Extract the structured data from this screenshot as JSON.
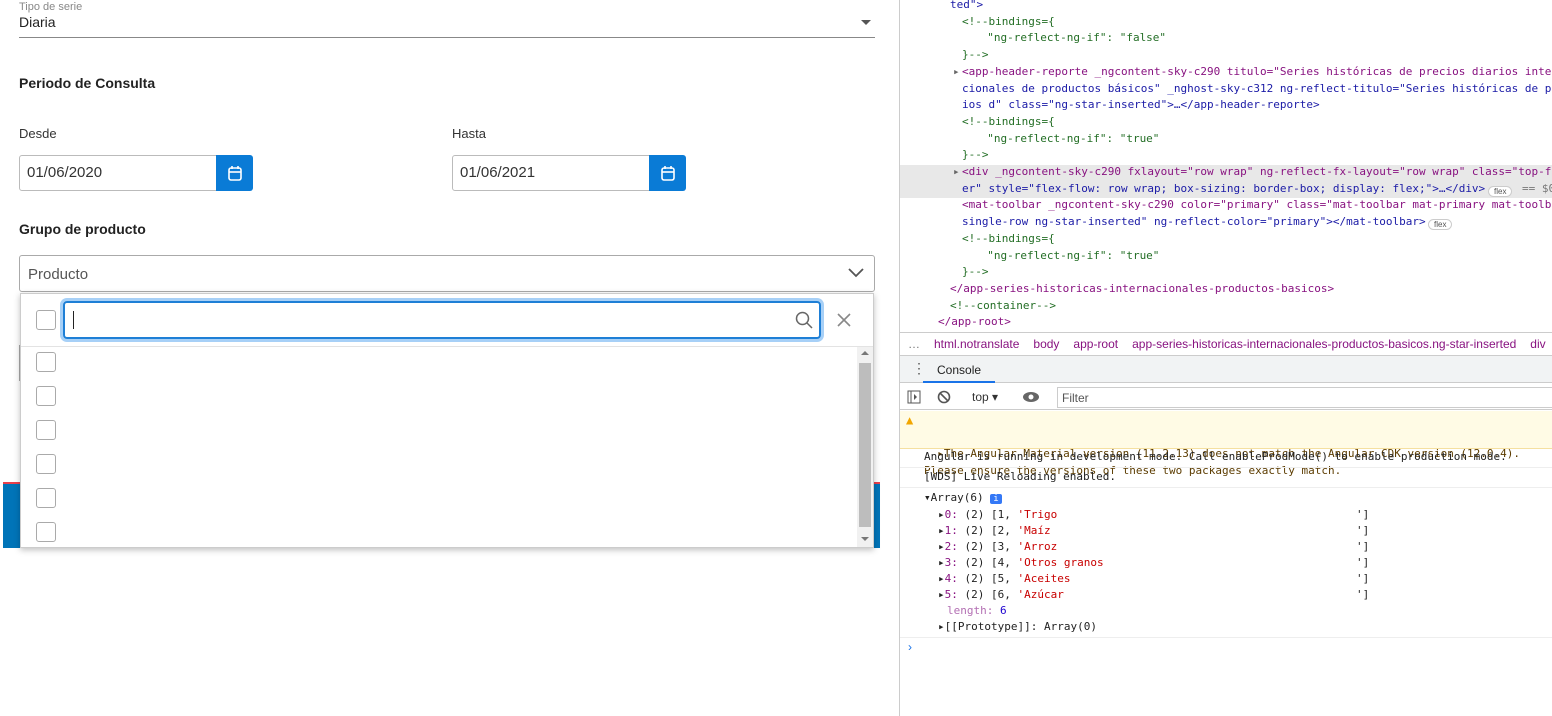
{
  "form": {
    "series_type": {
      "label": "Tipo de serie",
      "value": "Diaria"
    },
    "period_title": "Periodo de Consulta",
    "from": {
      "label": "Desde",
      "value": "01/06/2020"
    },
    "to": {
      "label": "Hasta",
      "value": "01/06/2021"
    },
    "group_title": "Grupo de producto",
    "product_select": {
      "placeholder": "Producto"
    },
    "dropdown": {
      "search_value": "",
      "option_count": 6
    },
    "colors": {
      "accent": "#0a7bd6"
    }
  },
  "devtools": {
    "elements": [
      "ted\">",
      "<!--bindings={",
      "  \"ng-reflect-ng-if\": \"false\"",
      "}-->",
      "<app-header-reporte _ngcontent-sky-c290 titulo=\"Series históricas de precios diarios inter",
      "cionales de productos básicos\" _nghost-sky-c312 ng-reflect-titulo=\"Series históricas de pr",
      "ios d\" class=\"ng-star-inserted\">…</app-header-reporte>",
      "<!--bindings={",
      "  \"ng-reflect-ng-if\": \"true\"",
      "}-->",
      "<div _ngcontent-sky-c290 fxlayout=\"row wrap\" ng-reflect-fx-layout=\"row wrap\" class=\"top-fo",
      "er\" style=\"flex-flow: row wrap; box-sizing: border-box; display: flex;\">…</div>",
      "<mat-toolbar _ngcontent-sky-c290 color=\"primary\" class=\"mat-toolbar mat-primary mat-toolba",
      "single-row ng-star-inserted\" ng-reflect-color=\"primary\"></mat-toolbar>",
      "<!--bindings={",
      "  \"ng-reflect-ng-if\": \"true\"",
      "}-->",
      "</app-series-historicas-internacionales-productos-basicos>",
      "<!--container-->",
      "</app-root>"
    ],
    "badges": {
      "flex": "flex",
      "eq": "== $0"
    },
    "breadcrumbs": [
      "html.notranslate",
      "body",
      "app-root",
      "app-series-historicas-internacionales-productos-basicos.ng-star-inserted",
      "div"
    ],
    "console_tab": "Console",
    "context": "top",
    "filter_placeholder": "Filter",
    "messages": {
      "warning1": "The Angular Material version (11.2.13) does not match the Angular CDK version (12.0.4).",
      "warning2": "Please ensure the versions of these two packages exactly match.",
      "dev_mode": "Angular is running in development mode. Call enableProdMode() to enable production mode.",
      "wds": "[WDS] Live Reloading enabled."
    },
    "array": {
      "header": "Array(6)",
      "info": "i",
      "items": [
        {
          "idx": "0:",
          "len": "(2)",
          "num": "[1,",
          "str": "'Trigo",
          "end": "']"
        },
        {
          "idx": "1:",
          "len": "(2)",
          "num": "[2,",
          "str": "'Maíz",
          "end": "']"
        },
        {
          "idx": "2:",
          "len": "(2)",
          "num": "[3,",
          "str": "'Arroz",
          "end": "']"
        },
        {
          "idx": "3:",
          "len": "(2)",
          "num": "[4,",
          "str": "'Otros granos",
          "end": "']"
        },
        {
          "idx": "4:",
          "len": "(2)",
          "num": "[5,",
          "str": "'Aceites",
          "end": "']"
        },
        {
          "idx": "5:",
          "len": "(2)",
          "num": "[6,",
          "str": "'Azúcar",
          "end": "']"
        }
      ],
      "length_key": "length:",
      "length_val": "6",
      "proto": "[[Prototype]]: Array(0)"
    }
  }
}
